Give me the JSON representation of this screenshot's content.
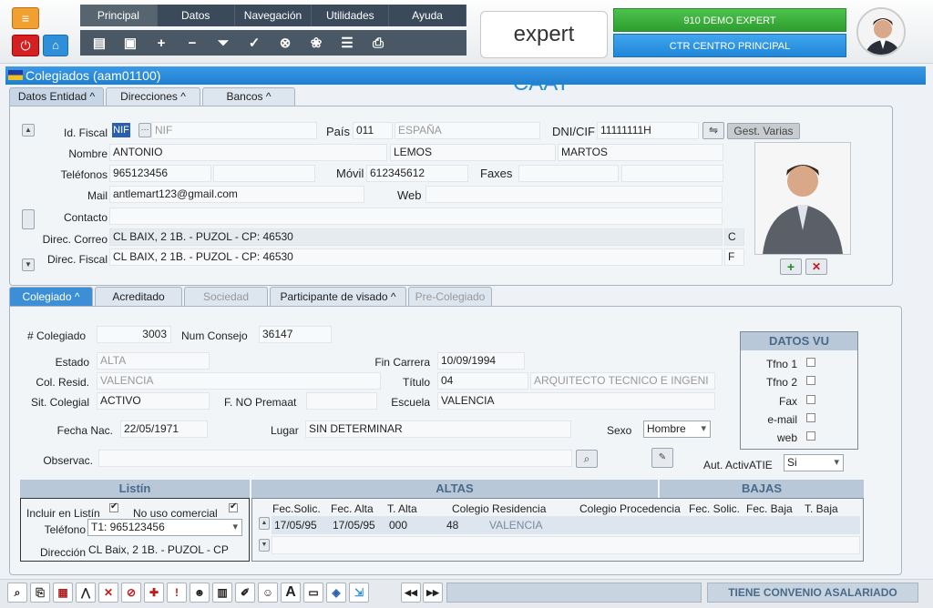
{
  "menu": [
    "Principal",
    "Datos",
    "Navegación",
    "Utilidades",
    "Ayuda"
  ],
  "toolbar_icons": [
    "new-document-icon",
    "save-icon",
    "add-icon",
    "remove-icon",
    "filter-icon",
    "confirm-icon",
    "cancel-icon",
    "group-icon",
    "report-icon",
    "print-icon"
  ],
  "logo": {
    "text": "expert",
    "brand": "CAAT",
    "mark": "®"
  },
  "user": {
    "name": "910 DEMO EXPERT",
    "center": "CTR CENTRO PRINCIPAL"
  },
  "window": {
    "title": "Colegiados (aam01100)"
  },
  "top_tabs": [
    "Datos Entidad ^",
    "Direcciones ^",
    "Bancos ^"
  ],
  "entity": {
    "id_fiscal_label": "Id. Fiscal",
    "id_type": "NIF",
    "id_type_desc": "NIF",
    "pais_label": "País",
    "pais_code": "011",
    "pais_name": "ESPAÑA",
    "dni_label": "DNI/CIF",
    "dni": "11111111H",
    "gest_label": "Gest. Varias",
    "nombre_label": "Nombre",
    "nombre": "ANTONIO",
    "apellido1": "LEMOS",
    "apellido2": "MARTOS",
    "telefonos_label": "Teléfonos",
    "telefono1": "965123456",
    "movil_label": "Móvil",
    "movil": "612345612",
    "faxes_label": "Faxes",
    "mail_label": "Mail",
    "mail": "antlemart123@gmail.com",
    "web_label": "Web",
    "contacto_label": "Contacto",
    "direc_correo_label": "Direc. Correo",
    "direc_correo": "CL BAIX, 2 1B. - PUZOL - CP: 46530",
    "direc_correo_code": "C",
    "direc_fiscal_label": "Direc. Fiscal",
    "direc_fiscal": "CL BAIX, 2 1B. - PUZOL - CP: 46530",
    "direc_fiscal_code": "F"
  },
  "sub_tabs": [
    "Colegiado ^",
    "Acreditado",
    "Sociedad",
    "Participante de visado ^",
    "Pre-Colegiado"
  ],
  "colegiado": {
    "num_label": "# Colegiado",
    "num": "3003",
    "consejo_label": "Num Consejo",
    "consejo": "36147",
    "estado_label": "Estado",
    "estado": "ALTA",
    "fin_carrera_label": "Fin Carrera",
    "fin_carrera": "10/09/1994",
    "col_resid_label": "Col. Resid.",
    "col_resid": "VALENCIA",
    "titulo_label": "Título",
    "titulo_code": "04",
    "titulo": "ARQUITECTO TECNICO E INGENI",
    "sit_label": "Sit. Colegial",
    "sit": "ACTIVO",
    "premaat_label": "F. NO Premaat",
    "escuela_label": "Escuela",
    "escuela": "VALENCIA",
    "fecha_nac_label": "Fecha Nac.",
    "fecha_nac": "22/05/1971",
    "lugar_label": "Lugar",
    "lugar": "SIN DETERMINAR",
    "sexo_label": "Sexo",
    "sexo": "Hombre",
    "observ_label": "Observac.",
    "aut_label": "Aut. ActivATIE",
    "aut": "Si"
  },
  "datos_vu": {
    "title": "DATOS VU",
    "items": [
      "Tfno 1",
      "Tfno 2",
      "Fax",
      "e-mail",
      "web"
    ]
  },
  "listin": {
    "title": "Listín",
    "incluir_label": "Incluir en Listín",
    "no_uso_label": "No uso comercial",
    "telefono_label": "Teléfono",
    "telefono": "T1: 965123456",
    "direccion_label": "Dirección",
    "direccion": "CL Baix, 2 1B. - PUZOL - CP"
  },
  "altas": {
    "title": "ALTAS",
    "headers": [
      "Fec.Solic.",
      "Fec. Alta",
      "T. Alta",
      "Colegio Residencia",
      "Colegio Procedencia"
    ],
    "row": [
      "17/05/95",
      "17/05/95",
      "000",
      "48",
      "VALENCIA"
    ]
  },
  "bajas": {
    "title": "BAJAS",
    "headers": [
      "Fec. Solic.",
      "Fec. Baja",
      "T. Baja"
    ]
  },
  "status": "TIENE CONVENIO ASALARIADO",
  "colors": {
    "accent": "#1f7fd0",
    "green": "#2e9e2e",
    "header": "#b8c8d8"
  }
}
